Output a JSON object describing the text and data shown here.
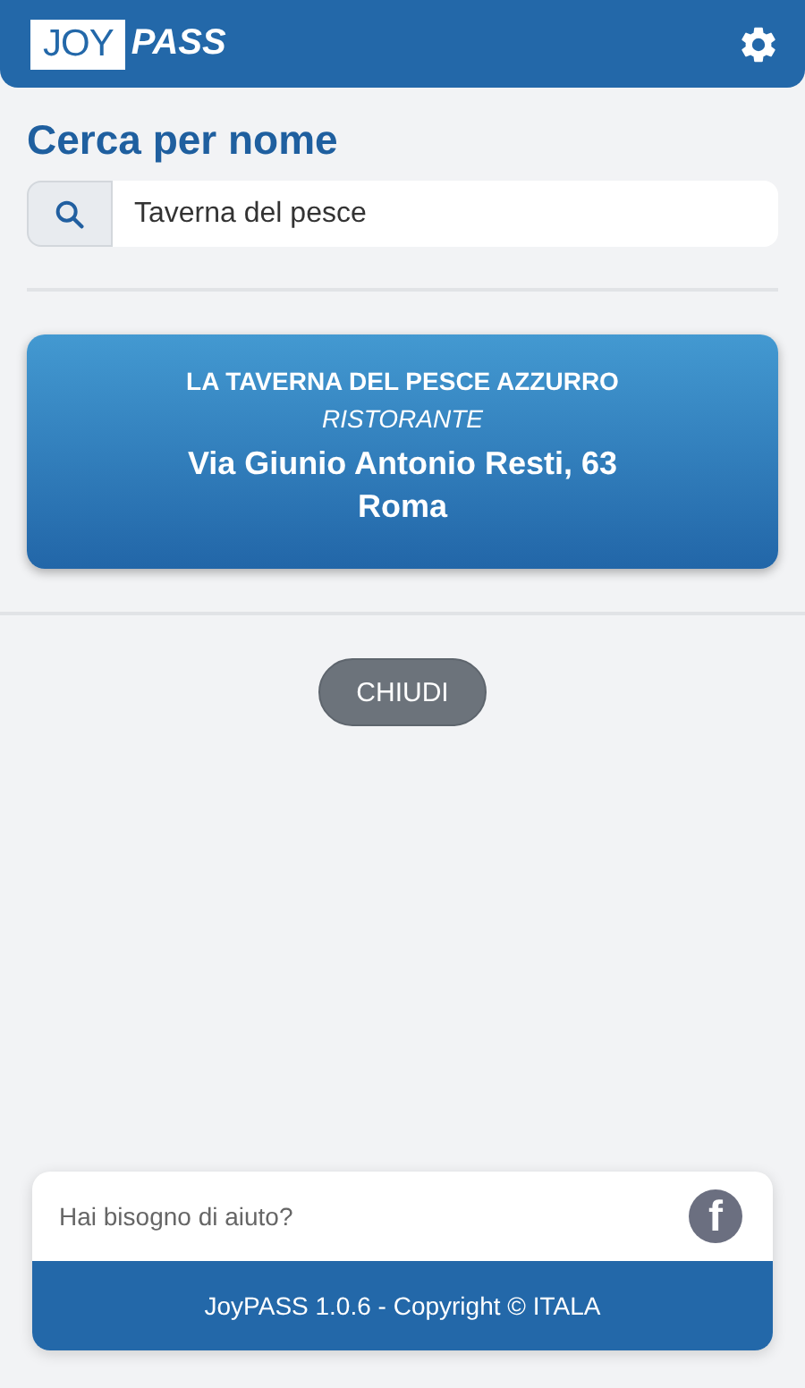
{
  "header": {
    "logo": {
      "part_1": "JOY",
      "part_2": "PASS"
    }
  },
  "title": "Cerca per nome",
  "search": {
    "value": "Taverna del pesce"
  },
  "results": [
    {
      "name": "LA TAVERNA DEL PESCE AZZURRO",
      "category": "RISTORANTE",
      "address": "Via Giunio Antonio Resti, 63",
      "city": "Roma"
    }
  ],
  "close_button": "CHIUDI",
  "footer": {
    "help": "Hai bisogno di aiuto?",
    "social_icon": "f",
    "copyright": "JoyPASS 1.0.6 - Copyright © ITALA"
  }
}
